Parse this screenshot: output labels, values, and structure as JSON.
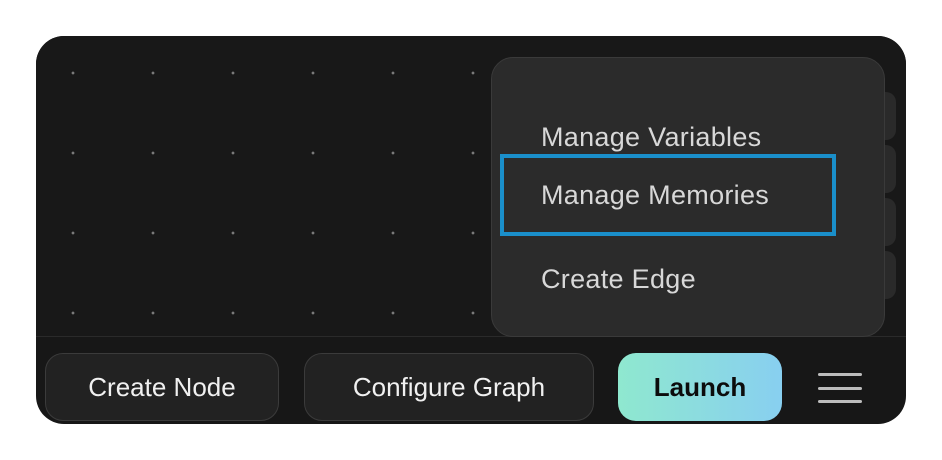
{
  "menu": {
    "items": [
      {
        "label": "Manage Variables"
      },
      {
        "label": "Manage Memories"
      },
      {
        "label": "Create Edge"
      }
    ]
  },
  "toolbar": {
    "create_node_label": "Create Node",
    "configure_graph_label": "Configure Graph",
    "launch_label": "Launch"
  },
  "icons": {
    "menu": "hamburger-menu-icon"
  },
  "colors": {
    "focus_outline": "#1a8fca",
    "launch_gradient_start": "#8fe8cf",
    "launch_gradient_end": "#88cff0"
  }
}
